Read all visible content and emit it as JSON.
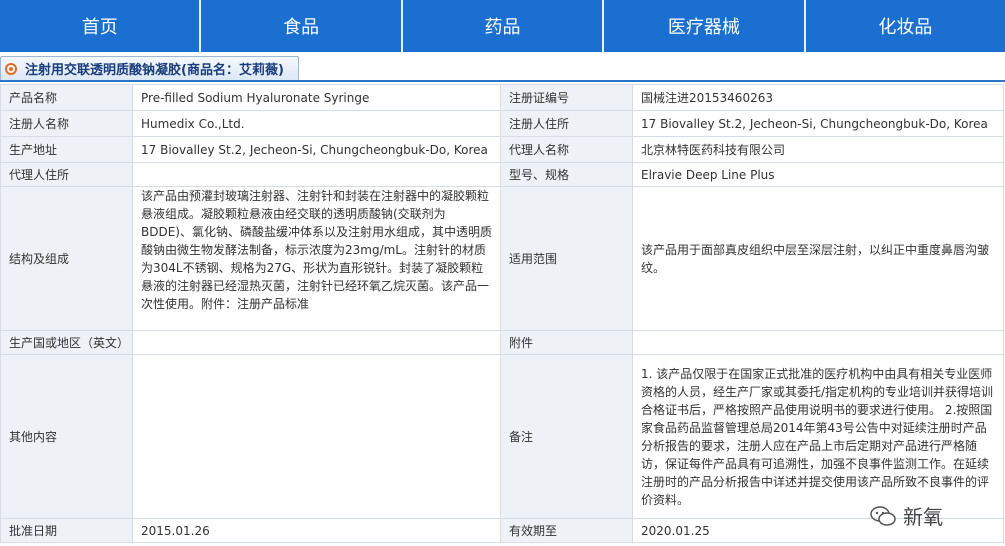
{
  "nav": {
    "items": [
      "首页",
      "食品",
      "药品",
      "医疗器械",
      "化妆品"
    ]
  },
  "title": "注射用交联透明质酸钠凝胶(商品名：艾莉薇)",
  "rows": {
    "r1": {
      "l1": "产品名称",
      "v1": "Pre-filled Sodium Hyaluronate Syringe",
      "l2": "注册证编号",
      "v2": "国械注进20153460263"
    },
    "r2": {
      "l1": "注册人名称",
      "v1": "Humedix Co.,Ltd.",
      "l2": "注册人住所",
      "v2": "17 Biovalley St.2, Jecheon-Si, Chungcheongbuk-Do, Korea"
    },
    "r3": {
      "l1": "生产地址",
      "v1": "17 Biovalley St.2, Jecheon-Si, Chungcheongbuk-Do, Korea",
      "l2": "代理人名称",
      "v2": "北京林特医药科技有限公司"
    },
    "r4": {
      "l1": "代理人住所",
      "v1": "",
      "l2": "型号、规格",
      "v2": "Elravie Deep Line Plus"
    },
    "r5": {
      "l1": "结构及组成",
      "v1": "该产品由预灌封玻璃注射器、注射针和封装在注射器中的凝胶颗粒悬液组成。凝胶颗粒悬液由经交联的透明质酸钠(交联剂为BDDE)、氯化钠、磷酸盐缓冲体系以及注射用水组成，其中透明质酸钠由微生物发酵法制备，标示浓度为23mg/mL。注射针的材质为304L不锈钢、规格为27G、形状为直形锐针。封装了凝胶颗粒悬液的注射器已经湿热灭菌，注射针已经环氧乙烷灭菌。该产品一次性使用。附件：注册产品标准",
      "l2": "适用范围",
      "v2": "该产品用于面部真皮组织中层至深层注射，以纠正中重度鼻唇沟皱纹。"
    },
    "r6": {
      "l1": "生产国或地区（英文）",
      "v1": "",
      "l2": "附件",
      "v2": ""
    },
    "r7": {
      "l1": "其他内容",
      "v1": "",
      "l2": "备注",
      "v2": "1. 该产品仅限于在国家正式批准的医疗机构中由具有相关专业医师资格的人员，经生产厂家或其委托/指定机构的专业培训并获得培训合格证书后，严格按照产品使用说明书的要求进行使用。 2.按照国家食品药品监督管理总局2014年第43号公告中对延续注册时产品分析报告的要求，注册人应在产品上市后定期对产品进行严格随访，保证每件产品具有可追溯性，加强不良事件监测工作。在延续注册时的产品分析报告中详述并提交使用该产品所致不良事件的评价资料。"
    },
    "r8": {
      "l1": "批准日期",
      "v1": "2015.01.26",
      "l2": "有效期至",
      "v2": "2020.01.25"
    }
  },
  "watermark": "新氧"
}
